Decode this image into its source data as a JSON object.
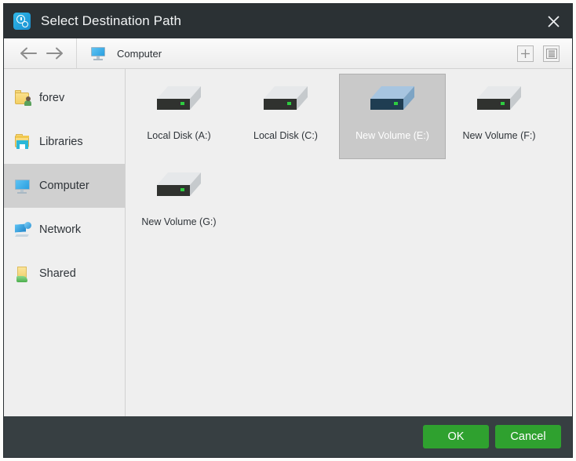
{
  "window": {
    "title": "Select Destination Path",
    "title_icon": "clock-gear-icon",
    "close_label": "✕"
  },
  "toolbar": {
    "back_label": "←",
    "forward_label": "→",
    "breadcrumb": {
      "icon": "computer-icon",
      "label": "Computer"
    },
    "new_folder_label": "+",
    "view_mode_label": "list-view-icon"
  },
  "sidebar": {
    "items": [
      {
        "label": "forev",
        "icon": "user-folder-icon",
        "selected": false
      },
      {
        "label": "Libraries",
        "icon": "libraries-icon",
        "selected": false
      },
      {
        "label": "Computer",
        "icon": "computer-icon",
        "selected": true
      },
      {
        "label": "Network",
        "icon": "network-icon",
        "selected": false
      },
      {
        "label": "Shared",
        "icon": "shared-folder-icon",
        "selected": false
      }
    ]
  },
  "content": {
    "drives": [
      {
        "label": "Local Disk (A:)",
        "icon": "hard-drive-icon",
        "selected": false
      },
      {
        "label": "Local Disk (C:)",
        "icon": "hard-drive-icon",
        "selected": false
      },
      {
        "label": "New Volume (E:)",
        "icon": "hard-drive-icon",
        "selected": true
      },
      {
        "label": "New Volume (F:)",
        "icon": "hard-drive-icon",
        "selected": false
      },
      {
        "label": "New Volume (G:)",
        "icon": "hard-drive-icon",
        "selected": false
      }
    ]
  },
  "footer": {
    "ok_label": "OK",
    "cancel_label": "Cancel"
  },
  "colors": {
    "titlebar_bg": "#2b3134",
    "footer_bg": "#373f42",
    "accent_button": "#2fa12f",
    "selection_bg": "#c9c9c9",
    "sidebar_selection_bg": "#d0d0d0",
    "panel_bg": "#efefef"
  }
}
